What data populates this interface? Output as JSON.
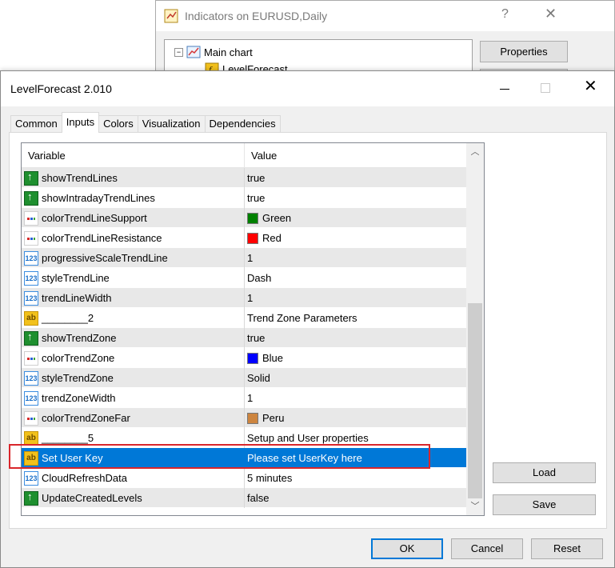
{
  "bg_window": {
    "title": "Indicators on EURUSD,Daily",
    "help": "?",
    "close": "✕",
    "tree": [
      {
        "label": "Main chart",
        "expander": "−"
      },
      {
        "label": "LevelForecast"
      }
    ],
    "properties_button": "Properties"
  },
  "dialog": {
    "title": "LevelForecast 2.010",
    "close": "✕",
    "tabs": [
      {
        "label": "Common"
      },
      {
        "label": "Inputs"
      },
      {
        "label": "Colors"
      },
      {
        "label": "Visualization"
      },
      {
        "label": "Dependencies"
      }
    ],
    "grid": {
      "headers": {
        "variable": "Variable",
        "value": "Value"
      },
      "rows": [
        {
          "type": "bool",
          "icon": "bool-param-icon",
          "variable": "showTrendLines",
          "value": "true"
        },
        {
          "type": "bool",
          "icon": "bool-param-icon",
          "variable": "showIntradayTrendLines",
          "value": "true"
        },
        {
          "type": "color",
          "icon": "color-param-icon",
          "variable": "colorTrendLineSupport",
          "value": "Green",
          "color": "#008000"
        },
        {
          "type": "color",
          "icon": "color-param-icon",
          "variable": "colorTrendLineResistance",
          "value": "Red",
          "color": "#ff0000"
        },
        {
          "type": "num",
          "icon": "number-param-icon",
          "variable": "progressiveScaleTrendLine",
          "value": "1"
        },
        {
          "type": "num",
          "icon": "number-param-icon",
          "variable": "styleTrendLine",
          "value": "Dash"
        },
        {
          "type": "num",
          "icon": "number-param-icon",
          "variable": "trendLineWidth",
          "value": "1"
        },
        {
          "type": "str",
          "icon": "string-param-icon",
          "variable": "________2",
          "value": "Trend Zone Parameters"
        },
        {
          "type": "bool",
          "icon": "bool-param-icon",
          "variable": "showTrendZone",
          "value": "true"
        },
        {
          "type": "color",
          "icon": "color-param-icon",
          "variable": "colorTrendZone",
          "value": "Blue",
          "color": "#0000ff"
        },
        {
          "type": "num",
          "icon": "number-param-icon",
          "variable": "styleTrendZone",
          "value": "Solid"
        },
        {
          "type": "num",
          "icon": "number-param-icon",
          "variable": "trendZoneWidth",
          "value": "1"
        },
        {
          "type": "color",
          "icon": "color-param-icon",
          "variable": "colorTrendZoneFar",
          "value": "Peru",
          "color": "#cd853f"
        },
        {
          "type": "str",
          "icon": "string-param-icon",
          "variable": "________5",
          "value": "Setup and User properties"
        },
        {
          "type": "str",
          "icon": "string-param-icon",
          "variable": "Set User Key",
          "value": "Please set UserKey here",
          "selected": true
        },
        {
          "type": "num",
          "icon": "number-param-icon",
          "variable": "CloudRefreshData",
          "value": "5 minutes"
        },
        {
          "type": "bool",
          "icon": "bool-param-icon",
          "variable": "UpdateCreatedLevels",
          "value": "false"
        }
      ]
    },
    "buttons": {
      "load": "Load",
      "save": "Save",
      "ok": "OK",
      "cancel": "Cancel",
      "reset": "Reset"
    },
    "highlight_color": "#d9262b",
    "selection_color": "#0078d7"
  }
}
